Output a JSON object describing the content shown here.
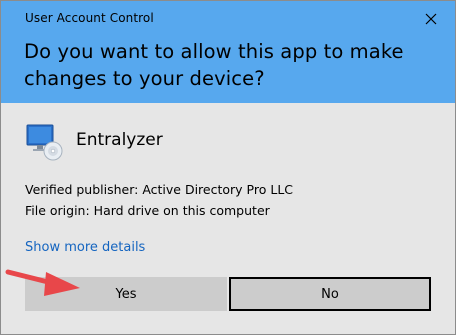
{
  "window": {
    "title": "User Account Control"
  },
  "header": {
    "question": "Do you want to allow this app to make changes to your device?"
  },
  "app": {
    "name": "Entralyzer",
    "icon": "computer-cd-icon"
  },
  "details": {
    "publisher": "Verified publisher: Active Directory Pro LLC",
    "origin": "File origin: Hard drive on this computer",
    "show_more": "Show more details"
  },
  "buttons": {
    "yes": "Yes",
    "no": "No"
  },
  "colors": {
    "header_bg": "#57a8ee",
    "body_bg": "#e6e6e6",
    "link": "#1565c0",
    "button_bg": "#cccccc",
    "annotation_arrow": "#e8474a"
  }
}
